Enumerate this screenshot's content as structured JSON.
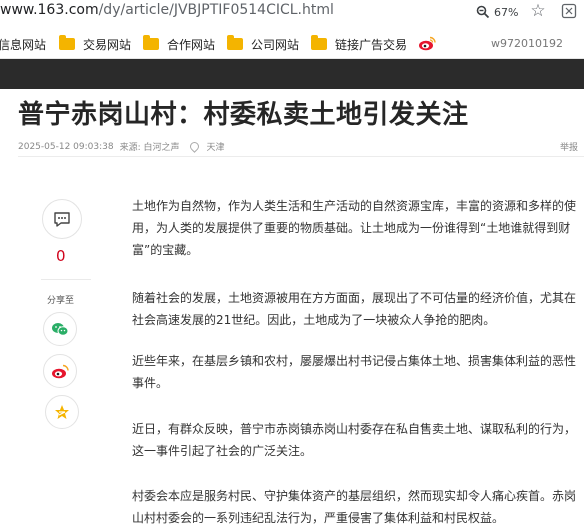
{
  "browser": {
    "url_host": "www.163.com",
    "url_path": "/dy/article/JVBJPTIF0514CICL.html",
    "zoom": "67%"
  },
  "bookmarks": {
    "items": [
      "信息网站",
      "交易网站",
      "合作网站",
      "公司网站",
      "链接广告交易"
    ],
    "user": "w972010192"
  },
  "article": {
    "title": "普宁赤岗山村：村委私卖土地引发关注",
    "datetime": "2025-05-12 09:03:38",
    "source": "来源: 白河之声",
    "location": "天津",
    "report": "举报",
    "paragraphs": [
      "土地作为自然物，作为人类生活和生产活动的自然资源宝库，丰富的资源和多样的使用，为人类的发展提供了重要的物质基础。让土地成为一份谁得到“土地谁就得到财富”的宝藏。",
      "随着社会的发展，土地资源被用在方方面面，展现出了不可估量的经济价值，尤其在社会高速发展的21世纪。因此，土地成为了一块被众人争抢的肥肉。",
      "近些年来，在基层乡镇和农村，屡屡爆出村书记侵占集体土地、损害集体利益的恶性事件。",
      "近日，有群众反映，普宁市赤岗镇赤岗山村委存在私自售卖土地、谋取私利的行为，这一事件引起了社会的广泛关注。",
      "村委会本应是服务村民、守护集体资产的基层组织，然而现实却令人痛心疾首。赤岗山村村委会的一系列违纪乱法行为，严重侵害了集体利益和村民权益。"
    ]
  },
  "share": {
    "comment_count": "0",
    "label": "分享至"
  },
  "colors": {
    "accent_red": "#d0021b",
    "wechat_green": "#2aae67",
    "weibo_red": "#e6162d",
    "qzone_yellow": "#f5b400",
    "header_dark": "#2b2b2b"
  }
}
